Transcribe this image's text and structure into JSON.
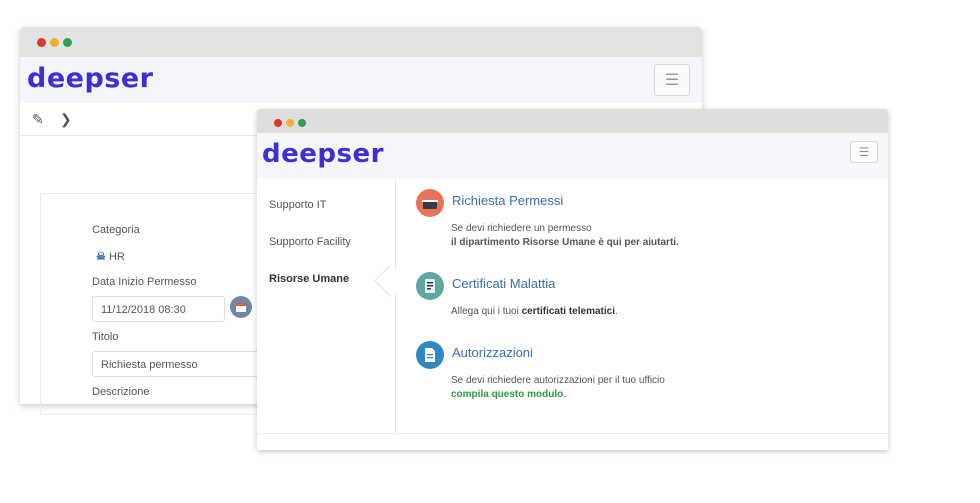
{
  "back_window": {
    "logo": "deepser",
    "menu_icon": "hamburger-icon",
    "toolbar": {
      "edit_icon": "edit-icon",
      "chevron_icon": "chevron-down-icon"
    },
    "form": {
      "category_label": "Categoria",
      "category_value": "HR",
      "start_label": "Data Inizio Permesso",
      "start_value": "11/12/2018 08:30",
      "title_label": "Titolo",
      "title_value": "Richiesta permesso",
      "description_label": "Descrizione"
    }
  },
  "front_window": {
    "logo": "deepser",
    "menu_icon": "hamburger-icon",
    "sidebar": {
      "items": [
        {
          "label": "Supporto IT"
        },
        {
          "label": "Supporto Facility"
        },
        {
          "label": "Risorse Umane",
          "active": true
        }
      ]
    },
    "services": [
      {
        "icon": "basket-icon",
        "icon_color": "#e8735a",
        "title": "Richiesta Permessi",
        "text1": "Se devi richiedere un permesso",
        "text2_strong": "il dipartimento Risorse Umane è qui per aiutarti."
      },
      {
        "icon": "medical-certificate-icon",
        "icon_color": "#5fa7a0",
        "title": "Certificati Malattia",
        "text_prefix": "Allega qui i tuoi ",
        "text_strong": "certificati telematici",
        "text_suffix": "."
      },
      {
        "icon": "document-icon",
        "icon_color": "#2f87c4",
        "title": "Autorizzazioni",
        "text1": "Se devi richiedere autorizzazioni per il tuo ufficio",
        "text2_strong": "compila questo modulo",
        "text2_suffix": "."
      }
    ]
  }
}
